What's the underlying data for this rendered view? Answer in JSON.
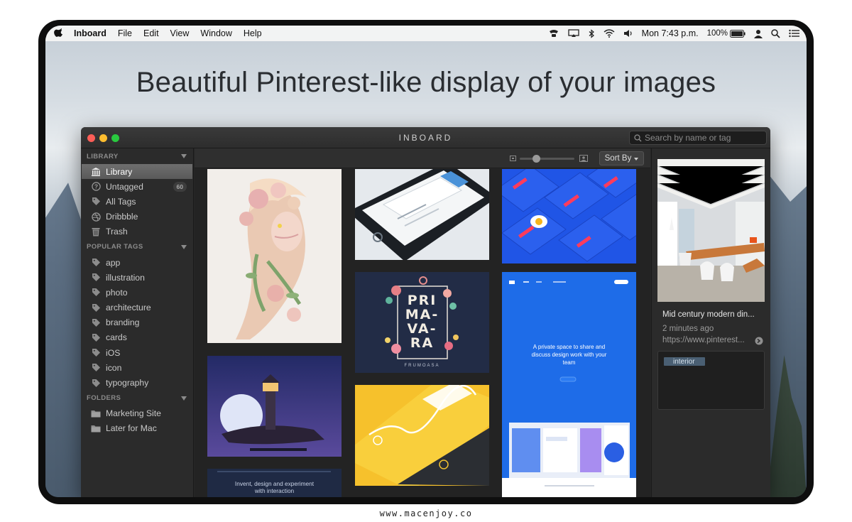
{
  "menubar": {
    "app_name": "Inboard",
    "menus": [
      "File",
      "Edit",
      "View",
      "Window",
      "Help"
    ],
    "clock": "Mon 7:43 p.m.",
    "battery": "100%"
  },
  "headline": "Beautiful Pinterest-like display of your images",
  "window": {
    "title": "INBOARD",
    "search_placeholder": "Search by name or tag",
    "sort_label": "Sort By"
  },
  "sidebar": {
    "library_header": "LIBRARY",
    "library": [
      {
        "label": "Library",
        "icon": "building-icon"
      },
      {
        "label": "Untagged",
        "icon": "question-icon",
        "badge": "60"
      },
      {
        "label": "All Tags",
        "icon": "tag-icon"
      },
      {
        "label": "Dribbble",
        "icon": "dribbble-icon"
      },
      {
        "label": "Trash",
        "icon": "trash-icon"
      }
    ],
    "tags_header": "POPULAR TAGS",
    "tags": [
      "app",
      "illustration",
      "photo",
      "architecture",
      "branding",
      "cards",
      "iOS",
      "icon",
      "typography"
    ],
    "folders_header": "FOLDERS",
    "folders": [
      "Marketing Site",
      "Later for Mac"
    ]
  },
  "grid": {
    "card_text": {
      "primavera_lines": [
        "PRI",
        "MA-",
        "VA-",
        "RA"
      ],
      "primavera_sub": "FRUMOASA",
      "blue_site_text": "A private space to share and discuss design work with your team",
      "invent_text": "Invent, design and experiment with interaction"
    }
  },
  "info": {
    "title": "Mid century modern din...",
    "time": "2 minutes ago",
    "url": "https://www.pinterest...",
    "tag": "interior"
  },
  "footer": "www.macenjoy.co",
  "colors": {
    "accent_blue": "#1e6be6",
    "yellow": "#f7c32a",
    "navy": "#232c45"
  }
}
